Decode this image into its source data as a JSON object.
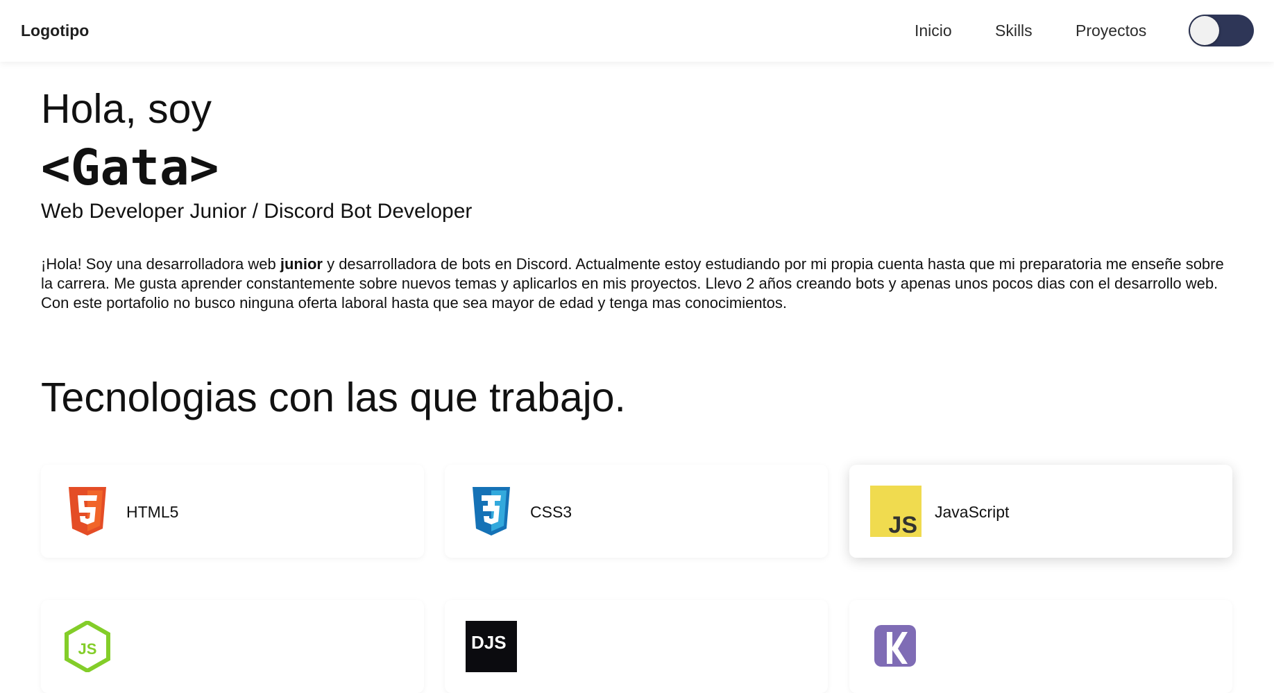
{
  "nav": {
    "logo": "Logotipo",
    "links": [
      "Inicio",
      "Skills",
      "Proyectos"
    ],
    "theme_toggle": {
      "state": "off",
      "track_color": "#2e3657",
      "knob_color": "#f1f1f1"
    }
  },
  "hero": {
    "greeting": "Hola, soy",
    "name": "<Gata>",
    "role": "Web Developer Junior / Discord Bot Developer",
    "about": {
      "before": "¡Hola! Soy una desarrolladora web ",
      "bold": "junior",
      "after": " y desarrolladora de bots en Discord. Actualmente estoy estudiando por mi propia cuenta hasta que mi preparatoria me enseñe sobre la carrera. Me gusta aprender constantemente sobre nuevos temas y aplicarlos en mis proyectos. Llevo 2 años creando bots y apenas unos pocos dias con el desarrollo web. Con este portafolio no busco ninguna oferta laboral hasta que sea mayor de edad y tenga mas conocimientos."
    }
  },
  "skills": {
    "title": "Tecnologias con las que trabajo.",
    "items": [
      {
        "label": "HTML5",
        "icon": "html5-icon",
        "color": "#e44d26"
      },
      {
        "label": "CSS3",
        "icon": "css3-icon",
        "color": "#1572b6"
      },
      {
        "label": "JavaScript",
        "icon": "javascript-icon",
        "color": "#f0db4f"
      },
      {
        "label": "",
        "icon": "nodejs-icon",
        "color": "#83cd29"
      },
      {
        "label": "",
        "icon": "discordjs-icon",
        "color": "#0b0b0f"
      },
      {
        "label": "",
        "icon": "kotlin-icon",
        "color": "#7f6cb5"
      }
    ]
  },
  "colors": {
    "background": "#ffffff",
    "text": "#111111",
    "toggle_track": "#2e3657"
  }
}
